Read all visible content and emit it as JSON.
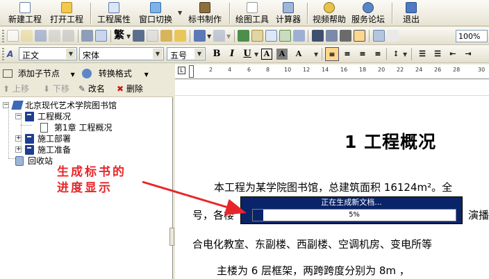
{
  "main_toolbar": {
    "new_project": "新建工程",
    "open_project": "打开工程",
    "project_props": "工程属性",
    "window_switch": "窗口切换",
    "bid_make": "标书制作",
    "draw_tools": "绘图工具",
    "calculator": "计算器",
    "video_help": "视频帮助",
    "forum": "服务论坛",
    "exit": "退出"
  },
  "format_toolbar": {
    "style": "正文",
    "font": "宋体",
    "size": "五号",
    "zoom": "100%",
    "trad_chinese": "繁"
  },
  "tree_toolbar": {
    "add_child": "添加子节点",
    "convert_format": "转换格式",
    "move_up": "上移",
    "move_down": "下移",
    "rename": "改名",
    "delete": "删除"
  },
  "tree": {
    "root": "北京现代艺术学院图书馆",
    "node1": "工程概况",
    "node1_child": "第1章  工程概况",
    "node2": "施工部署",
    "node3": "施工准备",
    "recycle": "回收站"
  },
  "ruler": {
    "ticks": [
      "2",
      "4",
      "6",
      "8",
      "10",
      "12",
      "14",
      "16",
      "18",
      "20",
      "22",
      "24",
      "26",
      "28",
      "30"
    ]
  },
  "document": {
    "heading": "1  工程概况",
    "line1": "本工程为某学院图书馆，总建筑面积 16124m²。全",
    "line2_left": "号，各楼",
    "line2_right": "演播",
    "line3": "合电化教室、东副楼、西副楼、空调机房、变电所等",
    "line4": "主楼为  6  层框架，两跨跨度分别为  8m  ，"
  },
  "progress": {
    "title": "正在生成新文档...",
    "percent_text": "5%",
    "percent": 5
  },
  "annotation": {
    "line1": "生成标书的",
    "line2": "进度显示",
    "color": "#E8262A"
  },
  "colors": {
    "progress_bar": "#0A246A",
    "toolbar_bg": "#ECE9D8"
  }
}
